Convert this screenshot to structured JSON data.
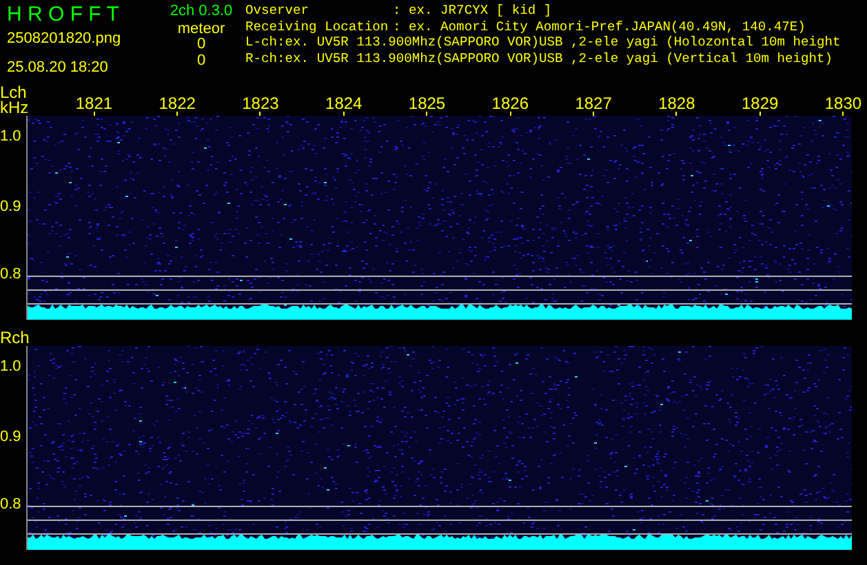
{
  "app": {
    "name": "H R O F F T",
    "version": "2ch 0.3.0"
  },
  "file_name": "2508201820.png",
  "timestamp": "25.08.20 18:20",
  "meteor": {
    "label": "meteor",
    "counts": [
      "0",
      "0"
    ]
  },
  "info": [
    {
      "kind": "field",
      "label": "Ovserver",
      "value": ": ex. JR7CYX [ kid ]"
    },
    {
      "kind": "field",
      "label": "Receiving Location",
      "value": ": ex. Aomori City Aomori-Pref.JAPAN(40.49N, 140.47E)"
    },
    {
      "kind": "line",
      "text": "L-ch:ex. UV5R 113.900Mhz(SAPPORO VOR)USB ,2-ele yagi (Holozontal 10m height"
    },
    {
      "kind": "line",
      "text": "R-ch:ex. UV5R 113.900Mhz(SAPPORO VOR)USB ,2-ele yagi (Vertical 10m height)"
    }
  ],
  "time_labels": [
    "1821",
    "1822",
    "1823",
    "1824",
    "1825",
    "1826",
    "1827",
    "1828",
    "1829",
    "1830"
  ],
  "channels": [
    {
      "name": "Lch",
      "unit": "kHz",
      "y_labels": [
        "1.0",
        "0.9",
        "0.8"
      ]
    },
    {
      "name": "Rch",
      "y_labels": [
        "1.0",
        "0.9",
        "0.8"
      ]
    }
  ]
}
